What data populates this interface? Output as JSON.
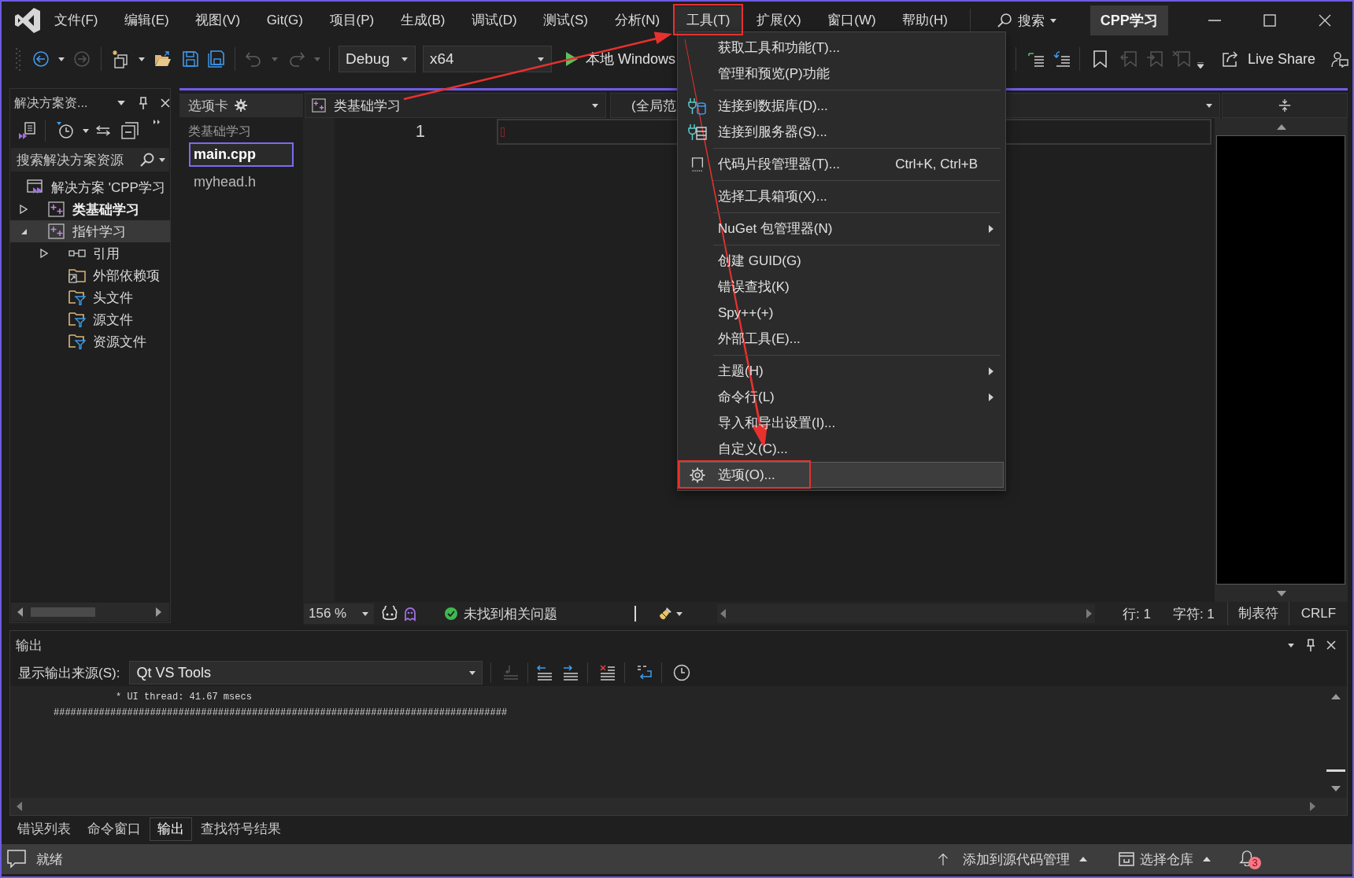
{
  "title_bar": {
    "menus": [
      {
        "label": "文件(F)",
        "selected": false
      },
      {
        "label": "编辑(E)",
        "selected": false
      },
      {
        "label": "视图(V)",
        "selected": false
      },
      {
        "label": "Git(G)",
        "selected": false
      },
      {
        "label": "项目(P)",
        "selected": false
      },
      {
        "label": "生成(B)",
        "selected": false
      },
      {
        "label": "调试(D)",
        "selected": false
      },
      {
        "label": "测试(S)",
        "selected": false
      },
      {
        "label": "分析(N)",
        "selected": false
      },
      {
        "label": "工具(T)",
        "selected": true
      },
      {
        "label": "扩展(X)",
        "selected": false
      },
      {
        "label": "窗口(W)",
        "selected": false
      },
      {
        "label": "帮助(H)",
        "selected": false
      }
    ],
    "search": "搜索",
    "solution_name": "CPP学习"
  },
  "toolbar": {
    "configuration": "Debug",
    "platform": "x64",
    "start_target": "本地 Windows",
    "live_share": "Live Share"
  },
  "solution_explorer": {
    "title": "解决方案资...",
    "search_placeholder": "搜索解决方案资源",
    "tree": [
      {
        "kind": "solution",
        "label": "解决方案 'CPP学习",
        "selected": false,
        "children": [
          {
            "kind": "project",
            "label": "类基础学习",
            "startup": true,
            "expanded": false,
            "selected": false
          },
          {
            "kind": "project",
            "label": "指针学习",
            "startup": false,
            "expanded": true,
            "selected": true,
            "children": [
              {
                "kind": "references",
                "label": "引用",
                "expanded": false,
                "selected": false
              },
              {
                "kind": "dependencies",
                "label": "外部依赖项",
                "selected": false
              },
              {
                "kind": "filter",
                "label": "头文件",
                "selected": false
              },
              {
                "kind": "filter",
                "label": "源文件",
                "selected": false
              },
              {
                "kind": "filter",
                "label": "资源文件",
                "selected": false
              }
            ]
          }
        ]
      }
    ]
  },
  "tab_well": {
    "title": "选项卡",
    "group": "类基础学习",
    "tabs": [
      {
        "label": "main.cpp",
        "selected": true
      },
      {
        "label": "myhead.h",
        "selected": false
      }
    ]
  },
  "editor": {
    "project": "类基础学习",
    "scope": "(全局范",
    "line_numbers": [
      "1"
    ],
    "zoom": "156 %",
    "issues": "未找到相关问题",
    "line": "行: 1",
    "column": "字符: 1",
    "indentation": "制表符",
    "line_ending": "CRLF"
  },
  "tools_menu": {
    "items": [
      {
        "kind": "item",
        "label": "获取工具和功能(T)...",
        "submenu": false,
        "selected": false
      },
      {
        "kind": "item",
        "label": "管理和预览(P)功能",
        "submenu": false,
        "selected": false
      },
      {
        "kind": "separator"
      },
      {
        "kind": "item",
        "label": "连接到数据库(D)...",
        "submenu": false,
        "selected": false
      },
      {
        "kind": "item",
        "label": "连接到服务器(S)...",
        "submenu": false,
        "selected": false
      },
      {
        "kind": "separator"
      },
      {
        "kind": "item",
        "label": "代码片段管理器(T)...",
        "shortcut": "Ctrl+K, Ctrl+B",
        "submenu": false,
        "selected": false
      },
      {
        "kind": "separator"
      },
      {
        "kind": "item",
        "label": "选择工具箱项(X)...",
        "submenu": false,
        "selected": false
      },
      {
        "kind": "separator"
      },
      {
        "kind": "item",
        "label": "NuGet 包管理器(N)",
        "submenu": true,
        "selected": false
      },
      {
        "kind": "separator"
      },
      {
        "kind": "item",
        "label": "创建 GUID(G)",
        "submenu": false,
        "selected": false
      },
      {
        "kind": "item",
        "label": "错误查找(K)",
        "submenu": false,
        "selected": false
      },
      {
        "kind": "item",
        "label": "Spy++(+)",
        "submenu": false,
        "selected": false
      },
      {
        "kind": "item",
        "label": "外部工具(E)...",
        "submenu": false,
        "selected": false
      },
      {
        "kind": "separator"
      },
      {
        "kind": "item",
        "label": "主题(H)",
        "submenu": true,
        "selected": false
      },
      {
        "kind": "item",
        "label": "命令行(L)",
        "submenu": true,
        "selected": false
      },
      {
        "kind": "item",
        "label": "导入和导出设置(I)...",
        "submenu": false,
        "selected": false
      },
      {
        "kind": "item",
        "label": "自定义(C)...",
        "submenu": false,
        "selected": false
      },
      {
        "kind": "item",
        "label": "选项(O)...",
        "submenu": false,
        "selected": true
      }
    ]
  },
  "output": {
    "title": "输出",
    "source_label": "显示输出来源(S):",
    "source": "Qt VS Tools",
    "lines": [
      "* UI thread: 41.67 msecs",
      "################################################################################"
    ]
  },
  "bottom_tabs": [
    {
      "label": "错误列表",
      "selected": false
    },
    {
      "label": "命令窗口",
      "selected": false
    },
    {
      "label": "输出",
      "selected": true
    },
    {
      "label": "查找符号结果",
      "selected": false
    }
  ],
  "status_bar": {
    "status": "就绪",
    "source_control": "添加到源代码管理",
    "repository": "选择仓库",
    "notifications": "3"
  }
}
